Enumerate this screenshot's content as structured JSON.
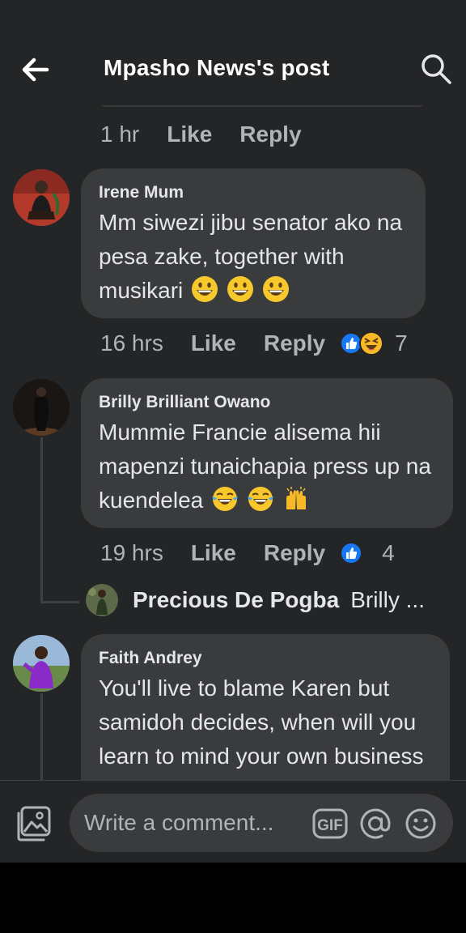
{
  "header": {
    "title": "Mpasho News's post",
    "back_icon": "arrow-left-icon",
    "search_icon": "search-icon"
  },
  "previous_comment": {
    "time": "1 hr",
    "like": "Like",
    "reply": "Reply"
  },
  "comments": [
    {
      "author": "Irene Mum",
      "text": "Mm siwezi jibu senator ako na pesa zake, together with musikari",
      "emojis": [
        "grinning-face",
        "grinning-face",
        "grinning-face"
      ],
      "time": "16 hrs",
      "like": "Like",
      "reply": "Reply",
      "reactions": [
        "like",
        "haha"
      ],
      "reaction_count": "7"
    },
    {
      "author": "Brilly Brilliant Owano",
      "text": "Mummie Francie  alisema hii mapenzi tunaichapia press up na kuendelea",
      "emojis": [
        "tears-of-joy",
        "tears-of-joy",
        "raising-hands"
      ],
      "time": "19 hrs",
      "like": "Like",
      "reply": "Reply",
      "reactions": [
        "like"
      ],
      "reaction_count": "4",
      "reply_preview": {
        "author": "Precious De Pogba",
        "snippet": "Brilly ..."
      }
    },
    {
      "author": "Faith Andrey",
      "text": "You'll live to blame Karen but samidoh decides,  when will you learn to mind your own business and ruin this life already"
    }
  ],
  "composer": {
    "placeholder": "Write a comment...",
    "gif_label": "GIF",
    "photo_icon": "photo-icon",
    "mention_icon": "at-sign-icon",
    "emoji_icon": "smiley-icon"
  },
  "colors": {
    "background": "#242526",
    "bubble": "#3a3b3c",
    "text_primary": "#e4e6eb",
    "text_secondary": "#b0b3b8",
    "like_blue": "#1877f2",
    "haha_yellow": "#f7b928"
  }
}
